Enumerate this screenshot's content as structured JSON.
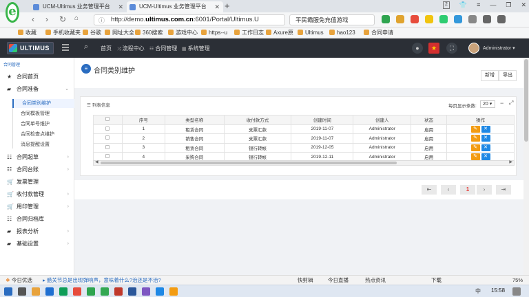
{
  "browser": {
    "tabs": [
      {
        "label": "UCM-Ultimus 业务管理平台",
        "active": false
      },
      {
        "label": "UCM-Ultimus 业务管理平台",
        "active": true
      }
    ],
    "new_tab": "+",
    "url_host_prefix": "http://demo.",
    "url_host_bold": "ultimus.com.cn",
    "url_rest": ":6001/Portal/Ultimus.U",
    "search_text": "平民霸服免充值游戏",
    "tab_count": "2",
    "bookmarks": [
      "收藏",
      "手机收藏夹",
      "谷歌",
      "网址大全",
      "360搜索",
      "游戏中心",
      "https--u",
      "工作日志",
      "Axure原",
      "Ultimus",
      "hao123",
      "合同申请"
    ]
  },
  "header": {
    "logo_text": "ULTIMUS",
    "nav": [
      "首页",
      "流程中心",
      "合同管理",
      "系统管理"
    ],
    "user": "Administrator"
  },
  "sidebar": {
    "top_label": "合同管理",
    "items": [
      {
        "label": "合同首页",
        "icon": "star-icon"
      },
      {
        "label": "合同准备",
        "icon": "briefcase-icon",
        "expanded": true
      },
      {
        "label": "合同起草",
        "icon": "sitemap-icon"
      },
      {
        "label": "合同台账",
        "icon": "sitemap-icon"
      },
      {
        "label": "发票管理",
        "icon": "cart-icon"
      },
      {
        "label": "收付款管理",
        "icon": "cart-icon"
      },
      {
        "label": "用印管理",
        "icon": "cart-icon"
      },
      {
        "label": "合同归档库",
        "icon": "sitemap-icon"
      },
      {
        "label": "报表分析",
        "icon": "briefcase-icon"
      },
      {
        "label": "基础设置",
        "icon": "briefcase-icon"
      }
    ],
    "subitems": [
      "合同类别维护",
      "合同模板管理",
      "合同单号维护",
      "合同检查点维护",
      "消息提醒设置"
    ]
  },
  "page": {
    "title": "合同类别维护",
    "add_label": "新增",
    "export_label": "导出",
    "list_title": "列表信息",
    "page_size_label": "每页显示条数:",
    "page_size": "20",
    "columns": [
      "",
      "序号",
      "类型名称",
      "收付款方式",
      "创建时间",
      "创建人",
      "状态",
      "操作"
    ],
    "rows": [
      {
        "no": "1",
        "name": "租赁合同",
        "pay": "支票汇款",
        "created": "2019-11-07",
        "creator": "Administrator",
        "status": "启用"
      },
      {
        "no": "2",
        "name": "销售合同",
        "pay": "支票汇款",
        "created": "2019-11-07",
        "creator": "Administrator",
        "status": "启用"
      },
      {
        "no": "3",
        "name": "租赁合同",
        "pay": "银行转帐",
        "created": "2019-12-05",
        "creator": "Administrator",
        "status": "启用"
      },
      {
        "no": "4",
        "name": "采购合同",
        "pay": "银行转帐",
        "created": "2019-12-11",
        "creator": "Administrator",
        "status": "启用"
      }
    ],
    "pagination": {
      "first": "⇤",
      "prev": "‹",
      "current": "1",
      "next": "›",
      "last": "⇥"
    }
  },
  "statusbar": {
    "left": "今日优选",
    "news": "腊关节总是出现弹响声，意味着什么?治还是不治?",
    "items": [
      "快剪辑",
      "今日直播",
      "热点资讯",
      "下载",
      "75%"
    ]
  },
  "taskbar": {
    "clock": "15:58",
    "lang": "中"
  }
}
